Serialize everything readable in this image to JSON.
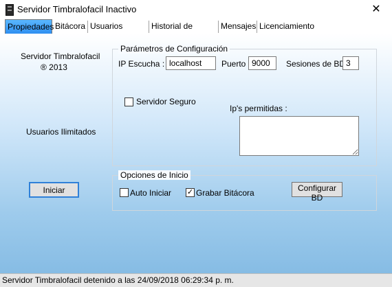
{
  "window": {
    "title": "Servidor Timbralofacil Inactivo",
    "close_symbol": "✕"
  },
  "tabs": [
    "Propiedades",
    "Bitácora",
    "Usuarios Activos",
    "Historial de Usuario",
    "Mensajes",
    "Licenciamiento"
  ],
  "left_panel": {
    "app_name": "Servidor Timbralofacil",
    "copyright": "® 2013",
    "users": "Usuarios Ilimitados",
    "start_button": "Iniciar"
  },
  "config": {
    "group_title": "Parámetros de Configuración",
    "ip_label": "IP Escucha :",
    "ip_value": "localhost",
    "port_label": "Puerto :",
    "port_value": "9000",
    "sessions_label": "Sesiones de BD",
    "sessions_value": "3",
    "secure_label": "Servidor Seguro",
    "secure_checked": false,
    "allowed_ips_label": "Ip's permitidas :",
    "allowed_ips_value": ""
  },
  "start_options": {
    "group_title": "Opciones de Inicio",
    "auto_start_label": "Auto Iniciar",
    "auto_start_checked": false,
    "record_log_label": "Grabar Bitácora",
    "record_log_checked": true,
    "configure_db_button": "Configurar BD"
  },
  "status_bar": {
    "text": "Servidor Timbralofacil detenido a las 24/09/2018 06:29:34 p. m."
  }
}
